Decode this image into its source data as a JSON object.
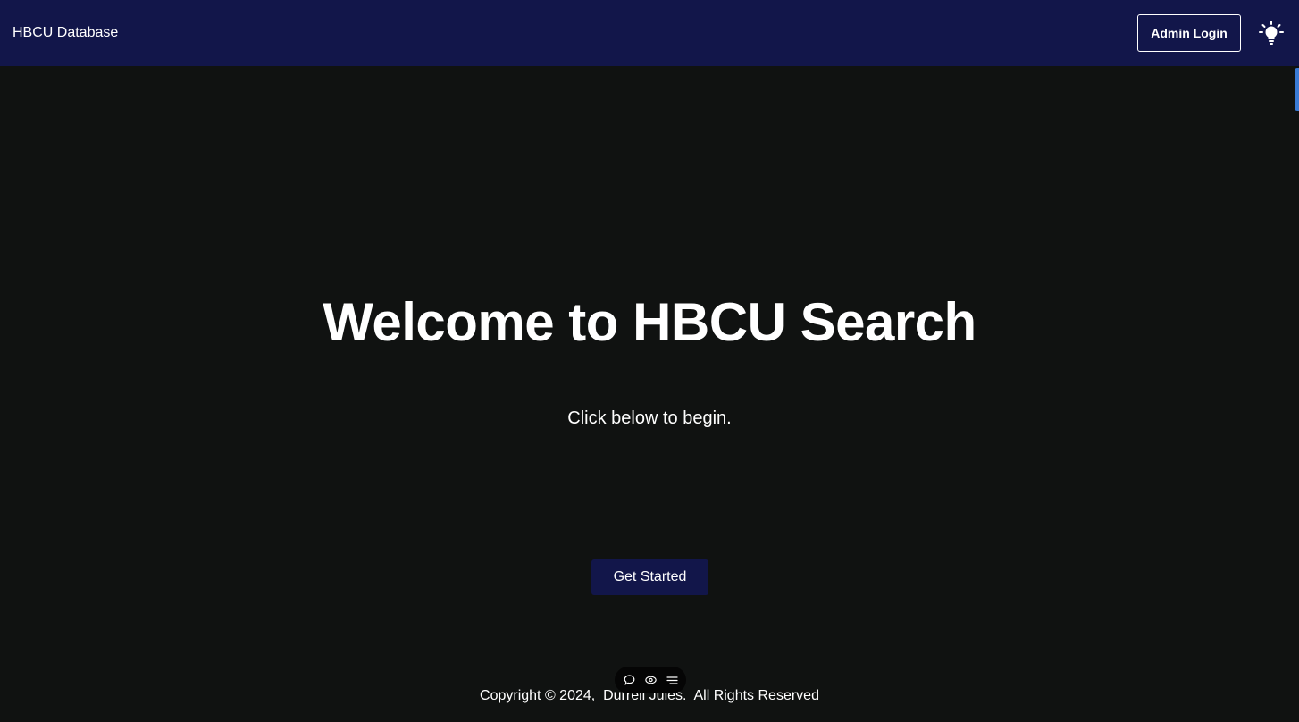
{
  "navbar": {
    "brand": "HBCU Database",
    "admin_login_label": "Admin Login",
    "theme_toggle_icon": "lightbulb-icon"
  },
  "hero": {
    "title": "Welcome to HBCU Search",
    "subtitle": "Click below to begin.",
    "cta_label": "Get Started"
  },
  "footer": {
    "copyright": "Copyright © 2024,  Durrell Jules.  All Rights Reserved"
  },
  "floating_toolbar": {
    "icons": [
      "comment-icon",
      "eye-icon",
      "menu-icon"
    ]
  },
  "colors": {
    "navbar_bg": "#12164a",
    "page_bg": "#101211",
    "accent": "#3a7bd5"
  }
}
